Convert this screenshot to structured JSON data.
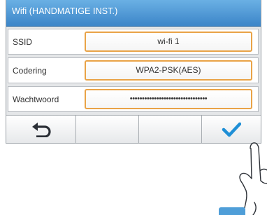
{
  "window": {
    "title": "Wifi (HANDMATIGE INST.)"
  },
  "fields": [
    {
      "label": "SSID",
      "value": "wi-fi 1"
    },
    {
      "label": "Codering",
      "value": "WPA2-PSK(AES)"
    },
    {
      "label": "Wachtwoord",
      "value": "••••••••••••••••••••••••••••••••"
    }
  ],
  "buttons": {
    "back_icon": "return-arrow-icon",
    "confirm_icon": "checkmark-icon"
  },
  "colors": {
    "title_bar": "#4a94d3",
    "field_border": "#e9a347",
    "checkmark": "#1f8fd6"
  }
}
